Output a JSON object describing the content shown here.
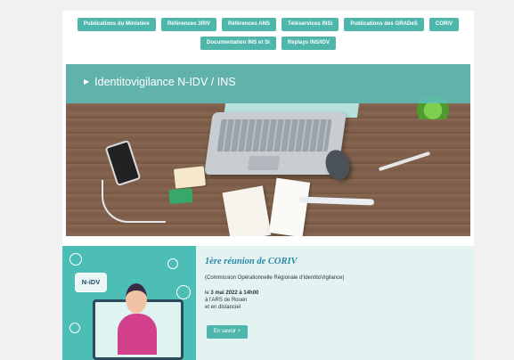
{
  "nav": {
    "items": [
      "Publications du Ministère",
      "Références 3RIV",
      "Références ANS",
      "Téléservices INSi",
      "Publications des GRADeS",
      "CORIV",
      "Documentation INS et SI",
      "Replays INS/IDV"
    ]
  },
  "banner": {
    "title": "Identitovigilance N-IDV / INS"
  },
  "event": {
    "badge": "N-iDV",
    "title": "1ère réunion de CORIV",
    "subtitle": "(Commission Opérationnelle Régionale d'IdentitoVigilance)",
    "date_prefix": "le ",
    "date": "3 mai 2022 à 14h00",
    "location": "à l'ARS de Rouen",
    "mode": "et en distanciel",
    "button": "En savoir +"
  },
  "colors": {
    "accent": "#4fb6ac",
    "title_blue": "#2c87a6",
    "event_bg": "#e2f3f2"
  }
}
